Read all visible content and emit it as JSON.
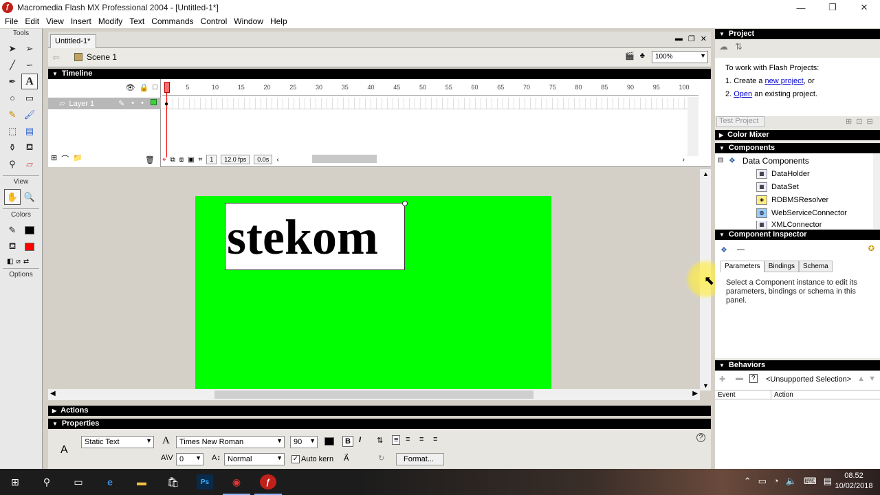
{
  "window": {
    "title": "Macromedia Flash MX Professional 2004 - [Untitled-1*]",
    "minimize": "—",
    "maximize": "❐",
    "close": "✕"
  },
  "menu": [
    "File",
    "Edit",
    "View",
    "Insert",
    "Modify",
    "Text",
    "Commands",
    "Control",
    "Window",
    "Help"
  ],
  "tools": {
    "header": "Tools",
    "view_header": "View",
    "colors_header": "Colors",
    "options_header": "Options"
  },
  "document": {
    "tab": "Untitled-1*",
    "scene": "Scene 1",
    "zoom": "100%"
  },
  "timeline": {
    "header": "Timeline",
    "layer_name": "Layer 1",
    "ruler_ticks": [
      "1",
      "5",
      "10",
      "15",
      "20",
      "25",
      "30",
      "35",
      "40",
      "45",
      "50",
      "55",
      "60",
      "65",
      "70",
      "75",
      "80",
      "85",
      "90",
      "95",
      "100"
    ],
    "current_frame": "1",
    "fps": "12.0 fps",
    "elapsed": "0.0s"
  },
  "stage": {
    "text": "stekom",
    "background_color": "#00ff00"
  },
  "actions": {
    "header": "Actions"
  },
  "properties": {
    "header": "Properties",
    "text_type": "Static Text",
    "font": "Times New Roman",
    "size": "90",
    "letter_spacing": "0",
    "baseline": "Normal",
    "auto_kern": "Auto kern",
    "format_button": "Format..."
  },
  "project_panel": {
    "header": "Project",
    "intro": "To work with Flash Projects:",
    "step1_prefix": "1. Create a ",
    "step1_link": "new project",
    "step1_suffix": ", or",
    "step2_prefix": "2. ",
    "step2_link": "Open",
    "step2_suffix": " an existing project.",
    "test_button": "Test Project"
  },
  "color_mixer": {
    "header": "Color Mixer"
  },
  "components": {
    "header": "Components",
    "group": "Data Components",
    "items": [
      "DataHolder",
      "DataSet",
      "RDBMSResolver",
      "WebServiceConnector",
      "XMLConnector"
    ]
  },
  "inspector": {
    "header": "Component Inspector",
    "selection": "—",
    "tabs": [
      "Parameters",
      "Bindings",
      "Schema"
    ],
    "message": "Select a Component instance to edit its parameters, bindings or schema in this panel."
  },
  "behaviors": {
    "header": "Behaviors",
    "selection": "<Unsupported Selection>",
    "columns": [
      "Event",
      "Action"
    ]
  },
  "taskbar": {
    "time": "08.52",
    "date": "10/02/2018"
  }
}
